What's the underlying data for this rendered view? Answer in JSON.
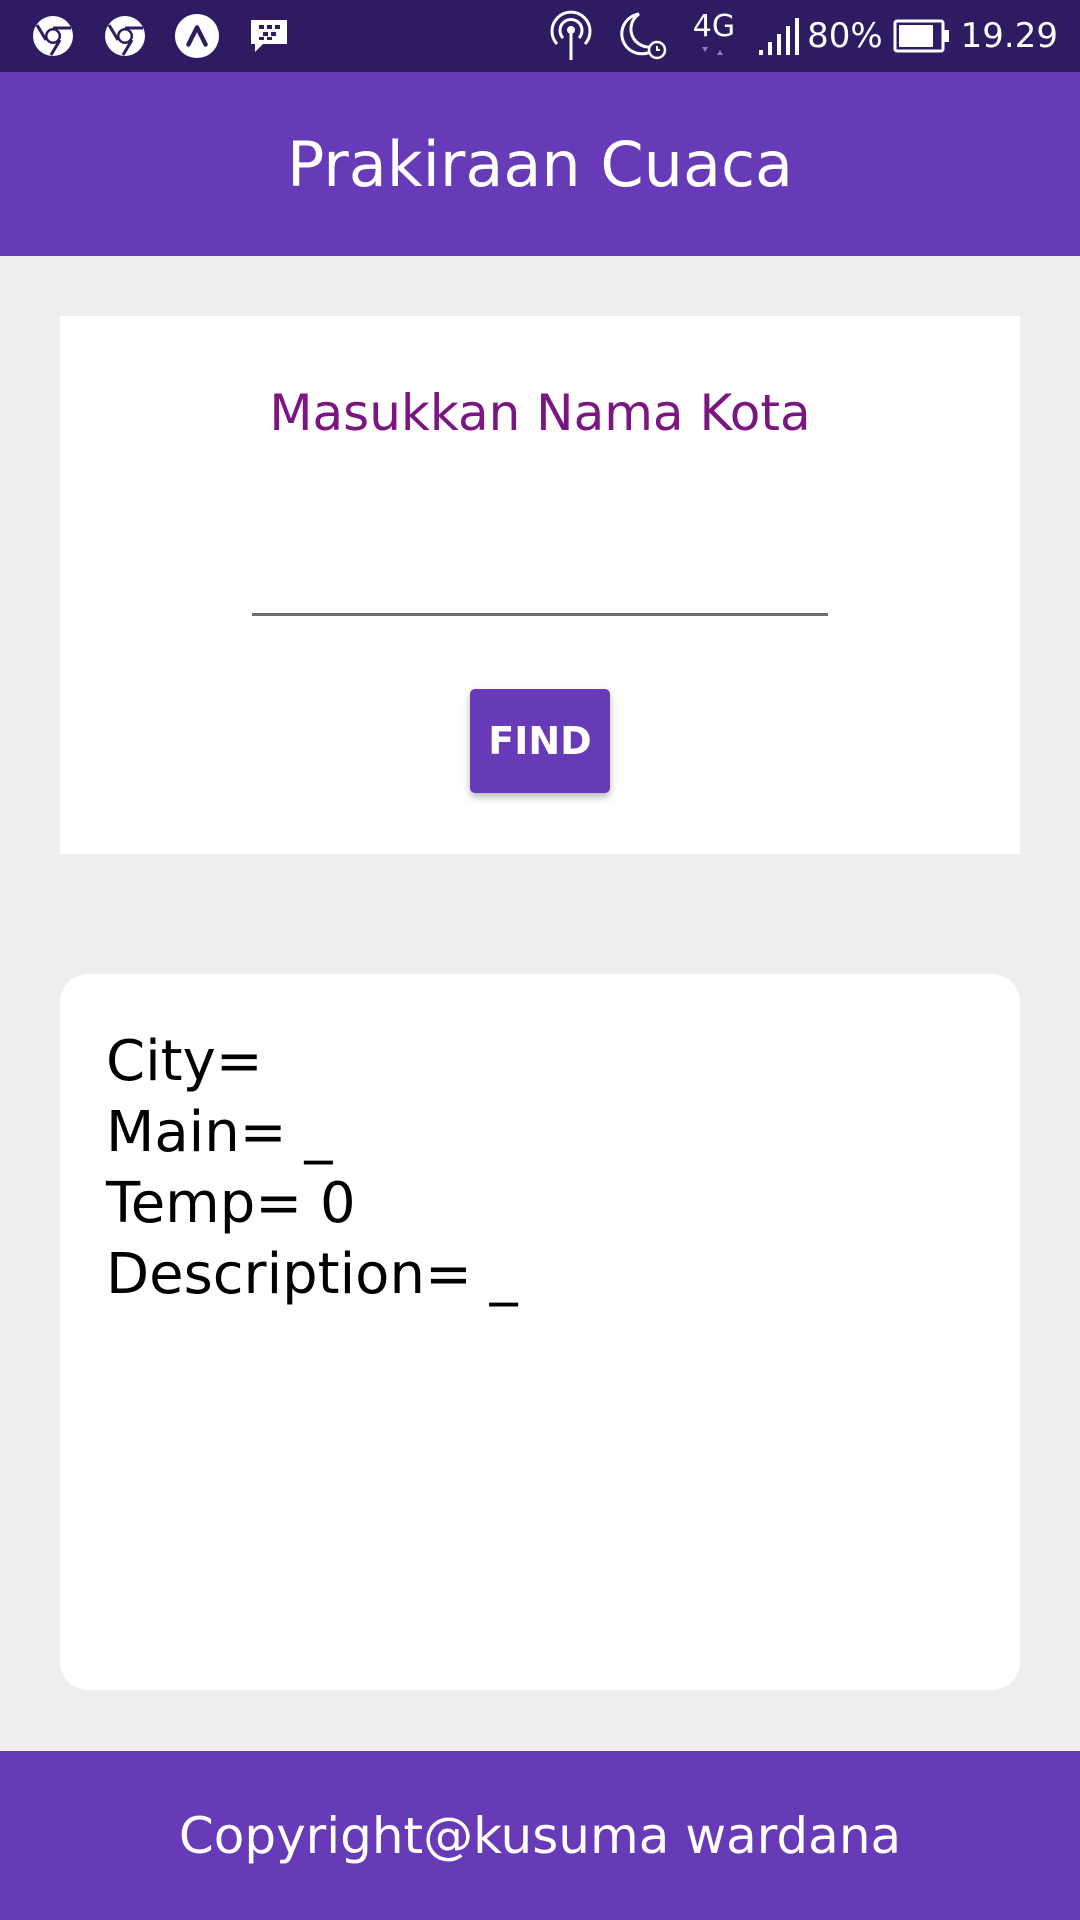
{
  "status_bar": {
    "left_icons": [
      "chrome-icon",
      "chrome-icon",
      "app-launcher-icon",
      "bbm-icon"
    ],
    "network": "4G",
    "battery": "80%",
    "time": "19.29"
  },
  "app_bar": {
    "title": "Prakiraan Cuaca"
  },
  "search_card": {
    "prompt": "Masukkan Nama Kota",
    "input_value": "",
    "input_placeholder": "",
    "find_label": "FIND"
  },
  "result_card": {
    "city": "City=",
    "main": "Main= _",
    "temp": "Temp= 0",
    "description": "Description= _"
  },
  "footer": {
    "text": "Copyright@kusuma wardana"
  },
  "colors": {
    "status_bar": "#2e1b61",
    "primary": "#673ab7",
    "prompt": "#7b1581",
    "background": "#eeeeee"
  }
}
